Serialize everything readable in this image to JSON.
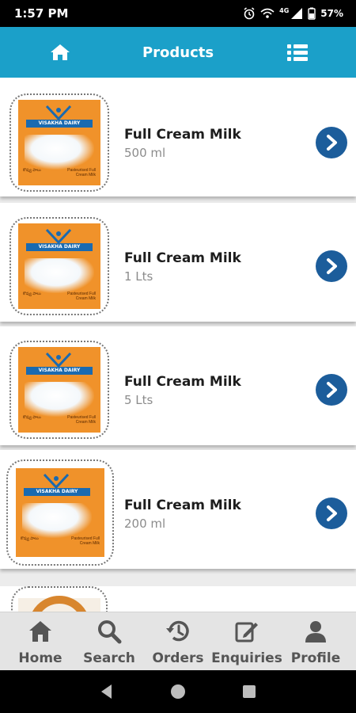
{
  "status_bar": {
    "time": "1:57 PM",
    "battery": "57%",
    "network": "4G"
  },
  "app_bar": {
    "title": "Products",
    "left_icon": "home-icon",
    "right_icon": "list-icon",
    "color": "#1ba0c9"
  },
  "pack_brand": "VISAKHA DAIRY",
  "pack_label_left": "కొవ్వు పాలు",
  "pack_label_right": "Pasteurised Full Cream Milk",
  "products": [
    {
      "name": "Full Cream Milk",
      "qty": "500 ml"
    },
    {
      "name": "Full Cream Milk",
      "qty": "1 Lts"
    },
    {
      "name": "Full Cream Milk",
      "qty": "5 Lts"
    },
    {
      "name": "Full Cream Milk",
      "qty": "200 ml"
    }
  ],
  "bottom_nav": [
    {
      "label": "Home",
      "icon": "home-icon"
    },
    {
      "label": "Search",
      "icon": "search-icon"
    },
    {
      "label": "Orders",
      "icon": "history-icon"
    },
    {
      "label": "Enquiries",
      "icon": "edit-icon"
    },
    {
      "label": "Profile",
      "icon": "user-icon"
    }
  ],
  "accent_color": "#1c5d9b"
}
